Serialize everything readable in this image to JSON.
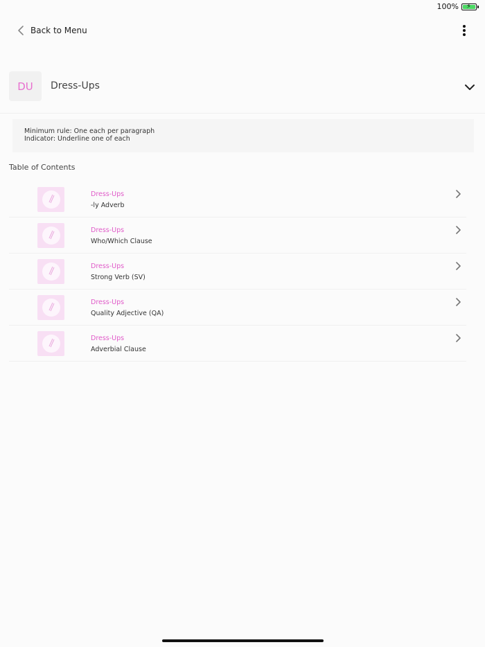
{
  "status": {
    "battery_percent": "100%",
    "battery_level": 1.0,
    "charging": true
  },
  "nav": {
    "back_label": "Back to Menu",
    "more_icon": "more-vertical-icon"
  },
  "section": {
    "badge": "DU",
    "title": "Dress-Ups",
    "accent_color": "#e86fcf",
    "chevron_icon": "chevron-down-icon"
  },
  "rules": {
    "line1": "Minimum rule: One each per paragraph",
    "line2": "Indicator: Underline one of each"
  },
  "toc": {
    "heading": "Table of Contents",
    "items": [
      {
        "category": "Dress-Ups",
        "title": "-ly Adverb"
      },
      {
        "category": "Dress-Ups",
        "title": "Who/Which Clause"
      },
      {
        "category": "Dress-Ups",
        "title": "Strong Verb (SV)"
      },
      {
        "category": "Dress-Ups",
        "title": "Quality Adjective (QA)"
      },
      {
        "category": "Dress-Ups",
        "title": "Adverbial Clause"
      }
    ]
  }
}
